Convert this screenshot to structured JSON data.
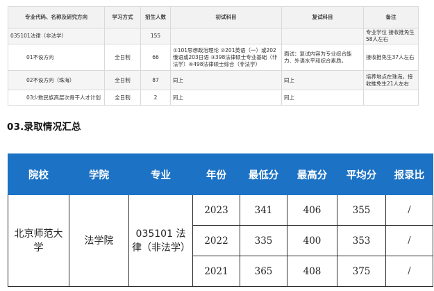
{
  "program_table": {
    "headers": [
      "专业代码、名称及研究方向",
      "学习方式",
      "招生人数",
      "初试科目",
      "复试科目",
      "备注"
    ],
    "rows": [
      {
        "name": "035101法律（非法学）",
        "mode": "",
        "count": "155",
        "exam": "",
        "retest": "",
        "note": "专业学位 接收推免生58人左右"
      },
      {
        "name": "01不设方向",
        "mode": "全日制",
        "count": "66",
        "exam": "①101思想政治理论 ②201英语（一）或202俄语或203日语 ③398法律硕士专业基础（非法学）④498法律硕士综合（非法学）",
        "retest": "面试：复试内容为专业综合能力、外语水平和综合素质。",
        "note": "接收推免生37人左右"
      },
      {
        "name": "02不设方向（珠海）",
        "mode": "全日制",
        "count": "87",
        "exam": "同上",
        "retest": "同上",
        "note": "培养地点在珠海。接收推免生21人左右"
      },
      {
        "name": "03少数民族高层次骨干人才计划",
        "mode": "全日制",
        "count": "2",
        "exam": "同上",
        "retest": "同上",
        "note": ""
      }
    ]
  },
  "section": {
    "title": "03.录取情况汇总"
  },
  "admission_table": {
    "headers": [
      "院校",
      "学院",
      "专业",
      "年份",
      "最低分",
      "最高分",
      "平均分",
      "报录比"
    ],
    "school": "北京师范大学",
    "college": "法学院",
    "major": "035101 法律（非法学）",
    "rows": [
      {
        "year": "2023",
        "min": "341",
        "max": "406",
        "avg": "355",
        "ratio": "/"
      },
      {
        "year": "2022",
        "min": "335",
        "max": "400",
        "avg": "353",
        "ratio": "/"
      },
      {
        "year": "2021",
        "min": "365",
        "max": "408",
        "avg": "375",
        "ratio": "/"
      }
    ]
  },
  "colors": {
    "header_blue": "#1c72c4",
    "grid_gray": "#d9d9d9"
  }
}
